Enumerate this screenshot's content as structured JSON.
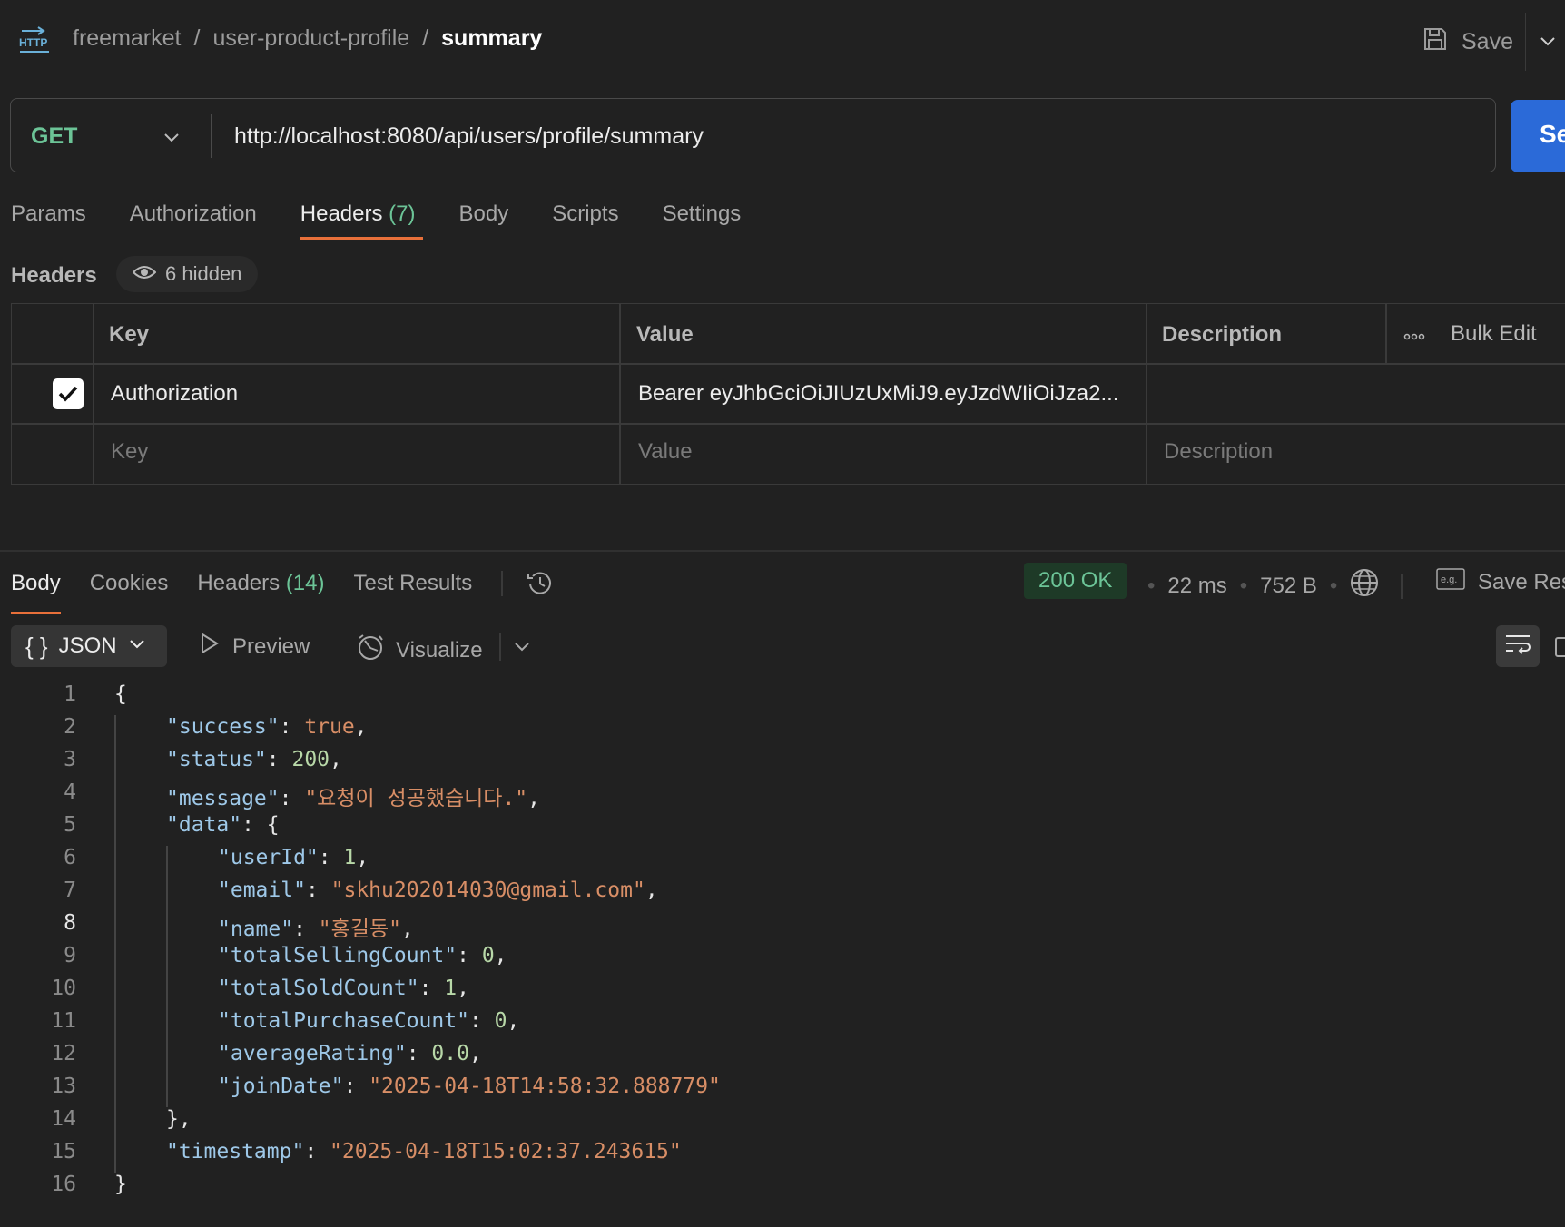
{
  "breadcrumb": {
    "items": [
      "freemarket",
      "user-product-profile"
    ],
    "separator": "/",
    "current": "summary"
  },
  "toolbar": {
    "save_label": "Save"
  },
  "request": {
    "method": "GET",
    "url": "http://localhost:8080/api/users/profile/summary",
    "send_label": "Se"
  },
  "request_tabs": [
    {
      "label": "Params"
    },
    {
      "label": "Authorization"
    },
    {
      "label": "Headers",
      "count": "(7)",
      "active": true
    },
    {
      "label": "Body"
    },
    {
      "label": "Scripts"
    },
    {
      "label": "Settings"
    }
  ],
  "headers_section": {
    "title": "Headers",
    "hidden_label": "6 hidden",
    "columns": {
      "key": "Key",
      "value": "Value",
      "description": "Description"
    },
    "bulk_edit": "Bulk Edit",
    "rows": [
      {
        "checked": true,
        "key": "Authorization",
        "value": "Bearer eyJhbGciOiJIUzUxMiJ9.eyJzdWIiOiJza2...",
        "description": ""
      }
    ],
    "placeholders": {
      "key": "Key",
      "value": "Value",
      "description": "Description"
    }
  },
  "response_tabs": [
    {
      "label": "Body",
      "active": true
    },
    {
      "label": "Cookies"
    },
    {
      "label": "Headers",
      "count": "(14)"
    },
    {
      "label": "Test Results"
    }
  ],
  "response_meta": {
    "status": "200 OK",
    "time": "22 ms",
    "size": "752 B",
    "save_response": "Save Res"
  },
  "body_toolbar": {
    "format": "JSON",
    "preview": "Preview",
    "visualize": "Visualize"
  },
  "code": {
    "active_line": 8,
    "lines": [
      {
        "n": "1",
        "indent": 0,
        "tokens": [
          [
            "p",
            "{"
          ]
        ]
      },
      {
        "n": "2",
        "indent": 1,
        "tokens": [
          [
            "k",
            "\"success\""
          ],
          [
            "p",
            ": "
          ],
          [
            "b",
            "true"
          ],
          [
            "p",
            ","
          ]
        ]
      },
      {
        "n": "3",
        "indent": 1,
        "tokens": [
          [
            "k",
            "\"status\""
          ],
          [
            "p",
            ": "
          ],
          [
            "n",
            "200"
          ],
          [
            "p",
            ","
          ]
        ]
      },
      {
        "n": "4",
        "indent": 1,
        "tokens": [
          [
            "k",
            "\"message\""
          ],
          [
            "p",
            ": "
          ],
          [
            "s",
            "\"요청이 성공했습니다.\""
          ],
          [
            "p",
            ","
          ]
        ]
      },
      {
        "n": "5",
        "indent": 1,
        "tokens": [
          [
            "k",
            "\"data\""
          ],
          [
            "p",
            ": {"
          ]
        ]
      },
      {
        "n": "6",
        "indent": 2,
        "tokens": [
          [
            "k",
            "\"userId\""
          ],
          [
            "p",
            ": "
          ],
          [
            "n",
            "1"
          ],
          [
            "p",
            ","
          ]
        ]
      },
      {
        "n": "7",
        "indent": 2,
        "tokens": [
          [
            "k",
            "\"email\""
          ],
          [
            "p",
            ": "
          ],
          [
            "s",
            "\"skhu202014030@gmail.com\""
          ],
          [
            "p",
            ","
          ]
        ]
      },
      {
        "n": "8",
        "indent": 2,
        "tokens": [
          [
            "k",
            "\"name\""
          ],
          [
            "p",
            ": "
          ],
          [
            "s",
            "\"홍길동\""
          ],
          [
            "p",
            ","
          ]
        ]
      },
      {
        "n": "9",
        "indent": 2,
        "tokens": [
          [
            "k",
            "\"totalSellingCount\""
          ],
          [
            "p",
            ": "
          ],
          [
            "n",
            "0"
          ],
          [
            "p",
            ","
          ]
        ]
      },
      {
        "n": "10",
        "indent": 2,
        "tokens": [
          [
            "k",
            "\"totalSoldCount\""
          ],
          [
            "p",
            ": "
          ],
          [
            "n",
            "1"
          ],
          [
            "p",
            ","
          ]
        ]
      },
      {
        "n": "11",
        "indent": 2,
        "tokens": [
          [
            "k",
            "\"totalPurchaseCount\""
          ],
          [
            "p",
            ": "
          ],
          [
            "n",
            "0"
          ],
          [
            "p",
            ","
          ]
        ]
      },
      {
        "n": "12",
        "indent": 2,
        "tokens": [
          [
            "k",
            "\"averageRating\""
          ],
          [
            "p",
            ": "
          ],
          [
            "n",
            "0.0"
          ],
          [
            "p",
            ","
          ]
        ]
      },
      {
        "n": "13",
        "indent": 2,
        "tokens": [
          [
            "k",
            "\"joinDate\""
          ],
          [
            "p",
            ": "
          ],
          [
            "s",
            "\"2025-04-18T14:58:32.888779\""
          ]
        ]
      },
      {
        "n": "14",
        "indent": 1,
        "tokens": [
          [
            "p",
            "},"
          ]
        ]
      },
      {
        "n": "15",
        "indent": 1,
        "tokens": [
          [
            "k",
            "\"timestamp\""
          ],
          [
            "p",
            ": "
          ],
          [
            "s",
            "\"2025-04-18T15:02:37.243615\""
          ]
        ]
      },
      {
        "n": "16",
        "indent": 0,
        "tokens": [
          [
            "p",
            "}"
          ]
        ]
      }
    ]
  },
  "colors": {
    "accent_tab": "#e8703a",
    "method_get": "#6cc497",
    "send_button": "#2b6ad8",
    "status_ok": "#6cc497"
  }
}
